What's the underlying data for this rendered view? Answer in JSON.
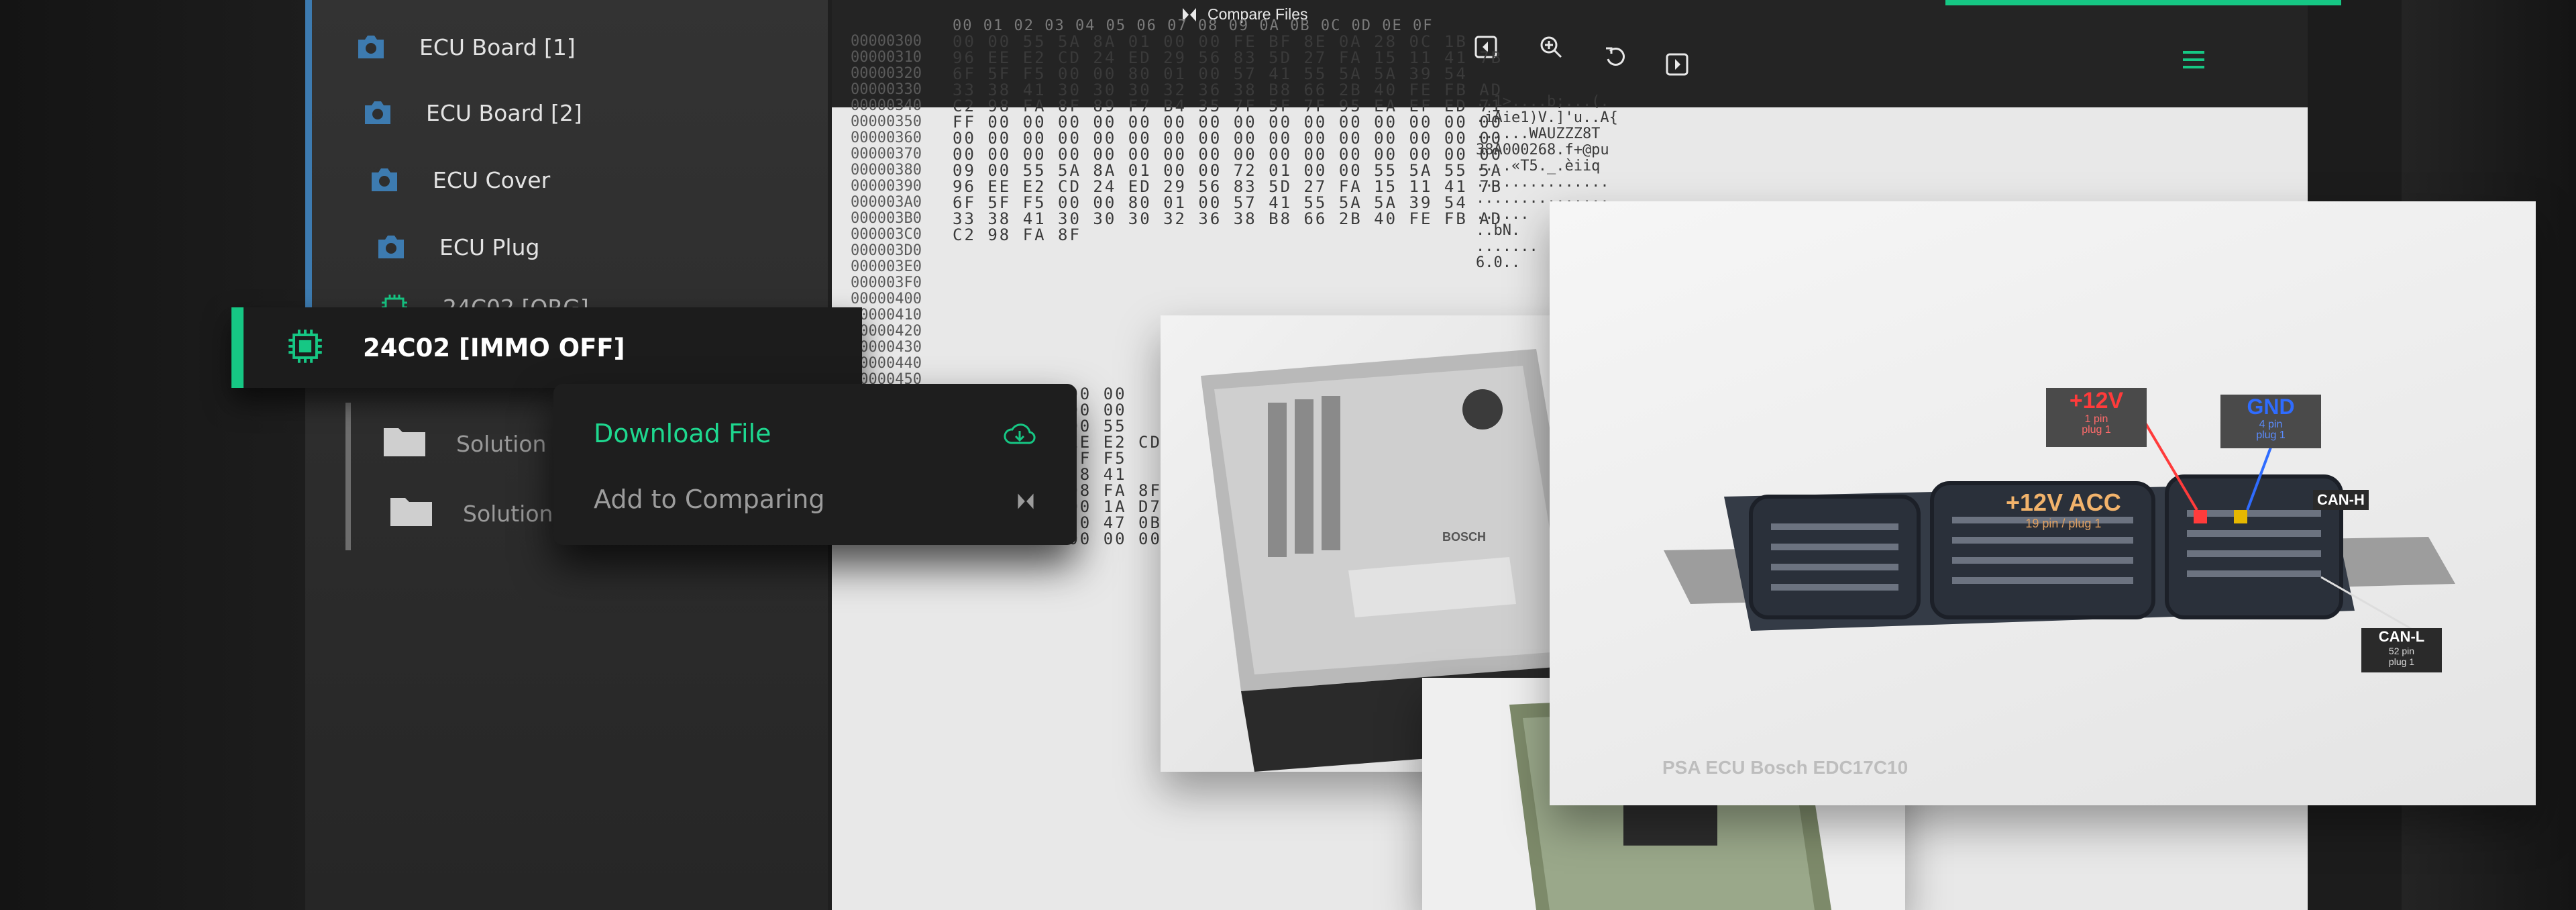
{
  "sidebar": {
    "items": [
      {
        "label": "ECU Board [1]",
        "icon": "camera-icon"
      },
      {
        "label": "ECU Board [2]",
        "icon": "camera-icon"
      },
      {
        "label": "ECU Cover",
        "icon": "camera-icon"
      },
      {
        "label": "ECU Plug",
        "icon": "camera-icon"
      },
      {
        "label": "24C02 [ORG]",
        "icon": "chip-icon"
      }
    ],
    "selected": {
      "label": "24C02 [IMMO OFF]",
      "icon": "chip-icon"
    },
    "folders": [
      {
        "label": "Solution 1",
        "icon": "folder-icon"
      },
      {
        "label": "Solution 2",
        "icon": "folder-icon"
      }
    ]
  },
  "context_menu": {
    "download": "Download File",
    "compare": "Add to Comparing"
  },
  "toolbar": {
    "title": "Compare Files",
    "buttons": [
      "back-icon",
      "zoom-in-icon",
      "undo-icon",
      "forward-icon",
      "hamburger-menu-icon"
    ]
  },
  "hex": {
    "header": "00 01 02 03 04 05 06 07 08 09 0A 0B 0C 0D 0E 0F",
    "offsets": "00000300\n00000310\n00000320\n00000330\n00000340\n00000350\n00000360\n00000370\n00000380\n00000390\n000003A0\n000003B0\n000003C0\n000003D0\n000003E0\n000003F0\n00000400\n00000410\n00000420\n00000430\n00000440\n00000450\n00000460\n00000470\n00000480\n00000490\n000004A0",
    "bytes": "00 00 55 5A 8A 01 00 00 FE BF 8E 0A 28 0C 1B\n96 EE E2 CD 24 ED 29 56 83 5D 27 FA 15 11 41 7B\n6F 5F F5 00 00 80 01 00 57 41 55 5A 5A 39 54\n33 38 41 30 30 30 32 36 38 B8 66 2B 40 FE FB AD\nC2 98 FA 8F 89 F7 B4 35 7F 5F 7F 95 EA EF ED 71\nFF 00 00 00 00 00 00 00 00 00 00 00 00 00 00 00\n00 00 00 00 00 00 00 00 00 00 00 00 00 00 00 00\n00 00 00 00 00 00 00 00 00 00 00 00 00 00 00 00\n09 00 55 5A 8A 01 00 00 72 01 00 00 55 5A 55 5A\n96 EE E2 CD 24 ED 29 56 83 5D 27 FA 15 11 41 7B\n6F 5F F5 00 00 80 01 00 57 41 55 5A 5A 39 54\n33 38 41 30 30 30 32 36 38 B8 66 2B 40 FE FB AD\nC2 98 FA 8F",
    "ascii": "..1>....b;...(.\n.iAie1)V.]'u..A{\n......WAUZZZ8T\n38A000268.f+@pu\n....«T5._.èiiq\n...............\n...............\n......\n..bN.\n.......\n6.0..\n",
    "more_bytes": [
      "FF 00 00",
      "00 00 00",
      "00 00 55",
      "96 EE E2 CD",
      "6F 5F F5",
      "33 38 41",
      "C2 98 FA 8F",
      "0B 00 1A D7",
      "42 50 47 0B",
      "00 00 00 00"
    ]
  },
  "photos": {
    "caption": "PSA ECU Bosch EDC17C10",
    "brand": "BOSCH",
    "tags": [
      {
        "title": "+12V",
        "sub": "1 pin\nplug 1",
        "title_color": "#ff3b3b"
      },
      {
        "title": "GND",
        "sub": "4 pin\nplug 1",
        "title_color": "#2f6cff"
      },
      {
        "title": "+12V ACC",
        "sub": "19 pin / plug 1",
        "title_color": "#ffb347"
      },
      {
        "title": "CAN-H",
        "sub": "",
        "title_color": "#ffffff"
      },
      {
        "title": "CAN-L",
        "sub": "52 pin\nplug 1",
        "title_color": "#ffffff"
      }
    ]
  },
  "colors": {
    "accent": "#16c784",
    "sidebar_accent": "#3d7bb0"
  }
}
